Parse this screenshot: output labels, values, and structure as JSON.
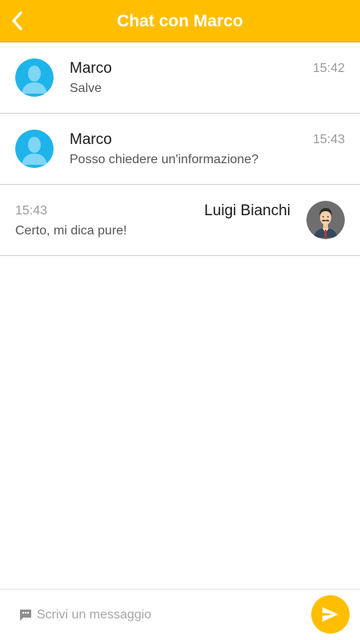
{
  "header": {
    "title": "Chat con Marco",
    "back_icon": "chevron-left-icon",
    "background": "#ffbf00"
  },
  "messages": [
    {
      "direction": "incoming",
      "sender": "Marco",
      "time": "15:42",
      "text": "Salve",
      "avatar_icon": "user-silhouette-icon"
    },
    {
      "direction": "incoming",
      "sender": "Marco",
      "time": "15:43",
      "text": "Posso chiedere un'informazione?",
      "avatar_icon": "user-silhouette-icon"
    },
    {
      "direction": "outgoing",
      "sender": "Luigi Bianchi",
      "time": "15:43",
      "text": "Certo, mi dica pure!",
      "avatar_icon": "man-with-mustache-avatar-icon"
    }
  ],
  "composer": {
    "placeholder": "Scrivi un messaggio",
    "value": "",
    "input_icon": "chat-bubble-icon",
    "send_icon": "send-icon"
  },
  "colors": {
    "accent": "#ffbf00",
    "avatar_blue": "#1eb4ea",
    "divider": "#d2d2d2"
  }
}
